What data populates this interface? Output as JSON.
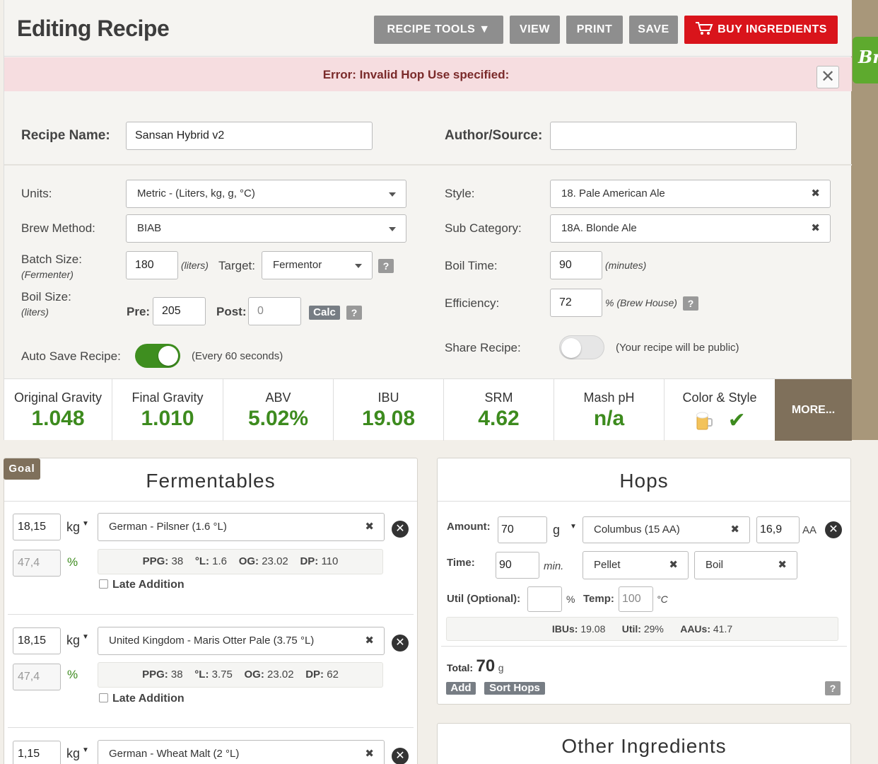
{
  "header": {
    "title": "Editing Recipe",
    "buttons": {
      "recipe_tools": "RECIPE TOOLS ▼",
      "view": "VIEW",
      "print": "PRINT",
      "save": "SAVE",
      "buy": "BUY INGREDIENTS"
    }
  },
  "side_badge": "Br",
  "error": {
    "message": "Error: Invalid Hop Use specified:",
    "close": "✕"
  },
  "recipe": {
    "name_label": "Recipe Name:",
    "name_value": "Sansan Hybrid v2",
    "author_label": "Author/Source:",
    "author_value": ""
  },
  "form": {
    "units_label": "Units:",
    "units_value": "Metric - (Liters, kg, g, °C)",
    "brew_method_label": "Brew Method:",
    "brew_method_value": "BIAB",
    "batch_size_label": "Batch Size:",
    "batch_size_sub": "(Fermenter)",
    "batch_size_value": "180",
    "batch_unit": "(liters)",
    "target_label": "Target:",
    "target_value": "Fermentor",
    "boil_size_label": "Boil Size:",
    "boil_size_sub": "(liters)",
    "pre_label": "Pre:",
    "pre_value": "205",
    "post_label": "Post:",
    "post_placeholder": "0",
    "calc_label": "Calc",
    "help": "?",
    "auto_save_label": "Auto Save Recipe:",
    "auto_save_note": "(Every 60 seconds)",
    "auto_save_on": true,
    "style_label": "Style:",
    "style_value": "18. Pale American Ale",
    "sub_category_label": "Sub Category:",
    "sub_category_value": "18A. Blonde Ale",
    "boil_time_label": "Boil Time:",
    "boil_time_value": "90",
    "boil_time_unit": "(minutes)",
    "efficiency_label": "Efficiency:",
    "efficiency_value": "72",
    "efficiency_unit": "% (Brew House)",
    "share_label": "Share Recipe:",
    "share_note": "(Your recipe will be public)",
    "share_on": false
  },
  "stats": [
    {
      "label": "Original Gravity",
      "value": "1.048"
    },
    {
      "label": "Final Gravity",
      "value": "1.010"
    },
    {
      "label": "ABV",
      "value": "5.02%"
    },
    {
      "label": "IBU",
      "value": "19.08"
    },
    {
      "label": "SRM",
      "value": "4.62"
    },
    {
      "label": "Mash pH",
      "value": "n/a"
    },
    {
      "label": "Color & Style",
      "value": "✔"
    }
  ],
  "more_label": "MORE...",
  "goal_label": "Goal",
  "fermentables": {
    "title": "Fermentables",
    "items": [
      {
        "amount": "18,15",
        "unit": "kg",
        "name": "German - Pilsner (1.6 °L)",
        "percent": "47,4",
        "pct_sign": "%",
        "ppg_label": "PPG:",
        "ppg": "38",
        "l_label": "°L:",
        "l": "1.6",
        "og_label": "OG:",
        "og": "23.02",
        "dp_label": "DP:",
        "dp": "110",
        "late_label": "Late Addition"
      },
      {
        "amount": "18,15",
        "unit": "kg",
        "name": "United Kingdom - Maris Otter Pale (3.75 °L)",
        "percent": "47,4",
        "pct_sign": "%",
        "ppg_label": "PPG:",
        "ppg": "38",
        "l_label": "°L:",
        "l": "3.75",
        "og_label": "OG:",
        "og": "23.02",
        "dp_label": "DP:",
        "dp": "62",
        "late_label": "Late Addition"
      },
      {
        "amount": "1,15",
        "unit": "kg",
        "name": "German - Wheat Malt (2 °L)"
      }
    ]
  },
  "hops": {
    "title": "Hops",
    "amount_label": "Amount:",
    "amount_value": "70",
    "amount_unit": "g",
    "variety": "Columbus (15 AA)",
    "aa_value": "16,9",
    "aa_label": "AA",
    "time_label": "Time:",
    "time_value": "90",
    "time_unit": "min.",
    "form": "Pellet",
    "use": "Boil",
    "util_label": "Util (Optional):",
    "util_pct": "%",
    "temp_label": "Temp:",
    "temp_placeholder": "100",
    "temp_unit": "°C",
    "ibus_label": "IBUs:",
    "ibus": "19.08",
    "util_stat_label": "Util:",
    "util_stat": "29%",
    "aaus_label": "AAUs:",
    "aaus": "41.7",
    "total_label": "Total:",
    "total_value": "70",
    "total_unit": "g",
    "add_label": "Add",
    "sort_label": "Sort Hops",
    "help": "?"
  },
  "other": {
    "title": "Other Ingredients"
  },
  "colors": {
    "accent_green": "#3d8b1e",
    "brown": "#7f705b",
    "red": "#d9141b",
    "error_bg": "#f6dde0"
  }
}
